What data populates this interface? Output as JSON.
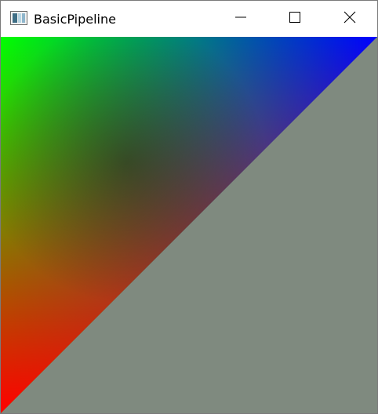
{
  "window": {
    "title": "BasicPipeline",
    "controls": {
      "minimize": "minimize-icon",
      "maximize": "maximize-icon",
      "close": "close-icon"
    }
  },
  "render": {
    "clear_color": "#7f8a7f",
    "triangle": {
      "vertex_colors": {
        "top_left": "#00ff00",
        "top_right": "#0000ff",
        "bottom_left": "#ff0000"
      }
    }
  }
}
